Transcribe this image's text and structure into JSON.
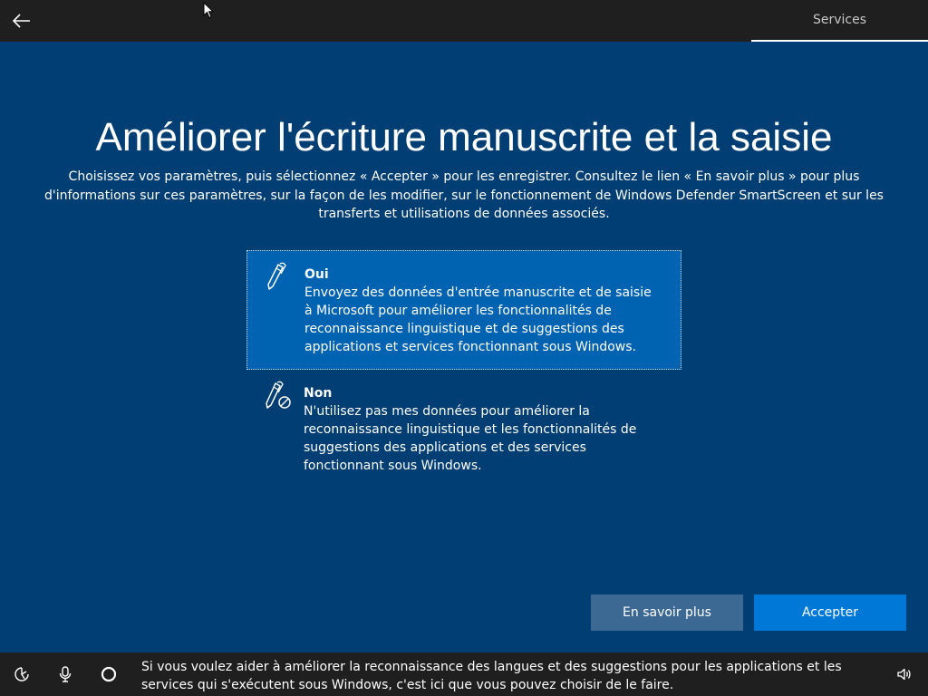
{
  "topbar": {
    "back_icon": "back-arrow-icon",
    "section_label": "Services"
  },
  "main": {
    "title": "Améliorer l'écriture manuscrite et la saisie",
    "description": "Choisissez vos paramètres, puis sélectionnez « Accepter » pour les enregistrer. Consultez le lien « En savoir plus » pour plus d'informations sur ces paramètres, sur la façon de les modifier, sur le fonctionnement de Windows Defender SmartScreen et sur les transferts et utilisations de données associés.",
    "options": [
      {
        "title": "Oui",
        "description": "Envoyez des données d'entrée manuscrite et de saisie à Microsoft pour améliorer les fonctionnalités de reconnaissance linguistique et de suggestions des applications et services fonctionnant sous Windows.",
        "icon": "pen-icon",
        "selected": true
      },
      {
        "title": "Non",
        "description": "N'utilisez pas mes données pour améliorer la reconnaissance linguistique et les fonctionnalités de suggestions des applications et des services fonctionnant sous Windows.",
        "icon": "pen-blocked-icon",
        "selected": false
      }
    ]
  },
  "buttons": {
    "learn_more": "En savoir plus",
    "accept": "Accepter"
  },
  "bottombar": {
    "narration": "Si vous voulez aider à améliorer la reconnaissance des langues et des suggestions pour les applications et les services qui s'exécutent sous Windows, c'est ici que vous pouvez choisir de le faire.",
    "icons": [
      "ease-of-access-icon",
      "microphone-icon",
      "cortana-icon",
      "volume-icon"
    ]
  },
  "colors": {
    "background": "#003e74",
    "bars": "#1f1f1f",
    "selected_option": "#0063b1",
    "accept_button": "#0078d7",
    "learn_more_button": "#3c6894"
  }
}
